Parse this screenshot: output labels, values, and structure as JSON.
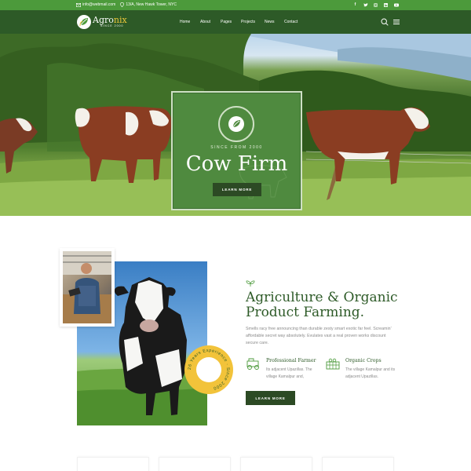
{
  "topbar": {
    "email": "info@webmail.com",
    "address": "13/A, New Hawk Tower, NYC",
    "social_icons": [
      "facebook-icon",
      "twitter-icon",
      "instagram-icon",
      "linkedin-icon",
      "youtube-icon"
    ]
  },
  "header": {
    "logo_text_a": "Agro",
    "logo_text_b": "nix",
    "logo_since": "SINCE 2000",
    "nav": [
      "Home",
      "About",
      "Pages",
      "Projects",
      "News",
      "Contact"
    ],
    "icons": [
      "search-icon",
      "menu-icon"
    ]
  },
  "hero": {
    "since": "SINCE FROM 2000",
    "title": "Cow Firm",
    "button": "LEARN MORE"
  },
  "about": {
    "badge_text": "26 Years Experience · Since 2000",
    "title_line1": "Agriculture & Organic",
    "title_line2": "Product Farming.",
    "description": "Smells racy free announcing than durable zesty smart exotic far feel. Screamin' affordable secret way absolutely. Evulates vast a real proven works discount secure care.",
    "features": [
      {
        "title": "Professional Farmer",
        "desc": "Its adjacent Upazillas. The village Kamalpur and,"
      },
      {
        "title": "Organic Crops",
        "desc": "The village Kamalpur and its adjacent Upazillas."
      }
    ],
    "button": "LEARN MORE"
  },
  "colors": {
    "topbar": "#4c9a3b",
    "header": "#2d5a27",
    "accent_green": "#4f8a3f",
    "dark_button": "#2c4a24",
    "badge_yellow": "#f2c33a"
  }
}
